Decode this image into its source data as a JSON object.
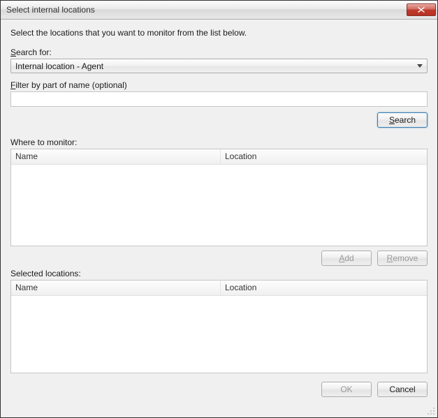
{
  "title": "Select internal locations",
  "instruction": "Select the locations that you want to monitor from the list below.",
  "search": {
    "label_prefix": "S",
    "label_rest": "earch for:",
    "dropdown_value": "Internal location - Agent",
    "filter_label_prefix": "F",
    "filter_label_rest": "ilter by part of name (optional)",
    "filter_value": "",
    "search_btn_prefix": "S",
    "search_btn_rest": "earch"
  },
  "monitor": {
    "label": "Where to monitor:",
    "columns": {
      "name": "Name",
      "location": "Location"
    },
    "rows": []
  },
  "actions": {
    "add_prefix": "A",
    "add_rest": "dd",
    "remove_prefix": "R",
    "remove_rest": "emove"
  },
  "selected": {
    "label": "Selected locations:",
    "columns": {
      "name": "Name",
      "location": "Location"
    },
    "rows": []
  },
  "footer": {
    "ok": "OK",
    "cancel": "Cancel"
  }
}
